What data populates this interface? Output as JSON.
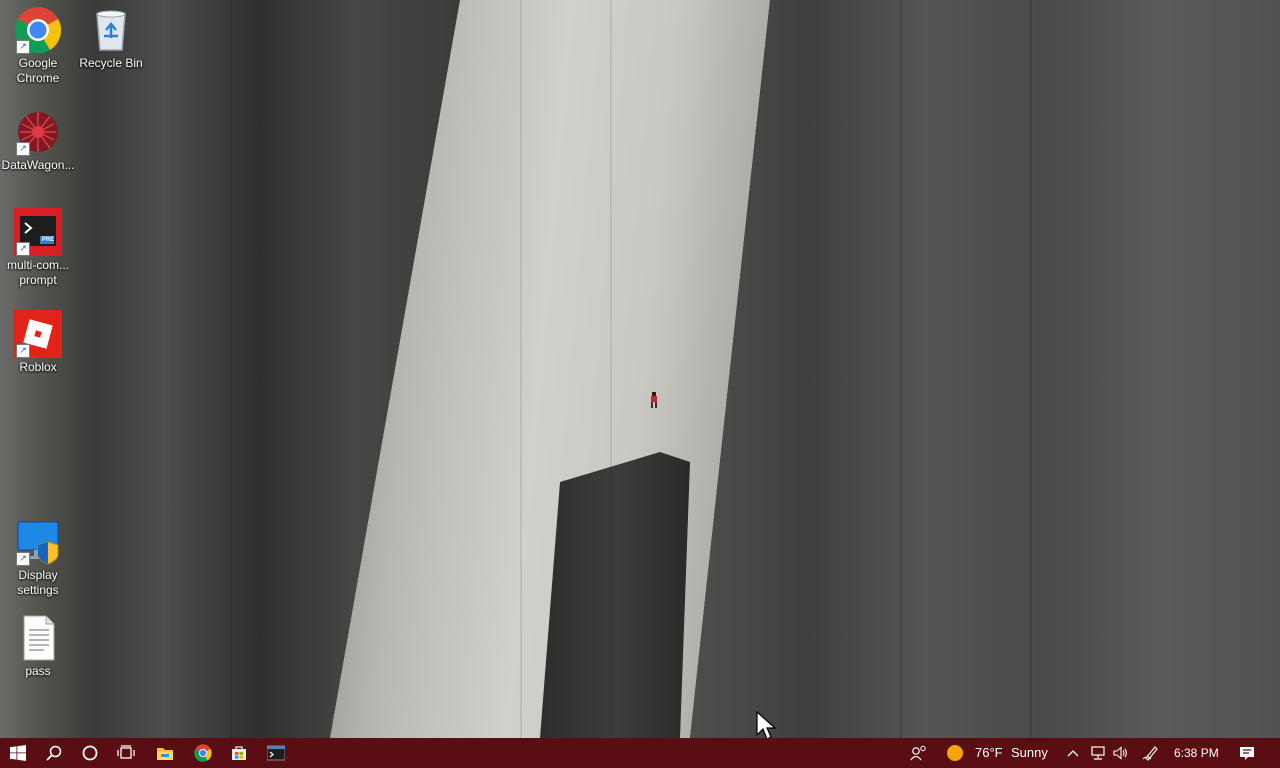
{
  "desktop": {
    "icons": [
      {
        "label": "Google Chrome",
        "icon": "chrome-icon"
      },
      {
        "label": "Recycle Bin",
        "icon": "recycle-bin-icon"
      },
      {
        "label": "DataWagon...",
        "icon": "datawagon-icon"
      },
      {
        "label": "multi-com... prompt",
        "icon": "terminal-icon"
      },
      {
        "label": "Roblox",
        "icon": "roblox-icon"
      },
      {
        "label": "Display settings",
        "icon": "display-settings-icon"
      },
      {
        "label": "pass",
        "icon": "text-file-icon"
      }
    ],
    "terminal_badge": "PRE"
  },
  "taskbar": {
    "color": "#5a0d12",
    "weather": {
      "temperature": "76°F",
      "condition": "Sunny"
    },
    "clock": "6:38 PM"
  }
}
